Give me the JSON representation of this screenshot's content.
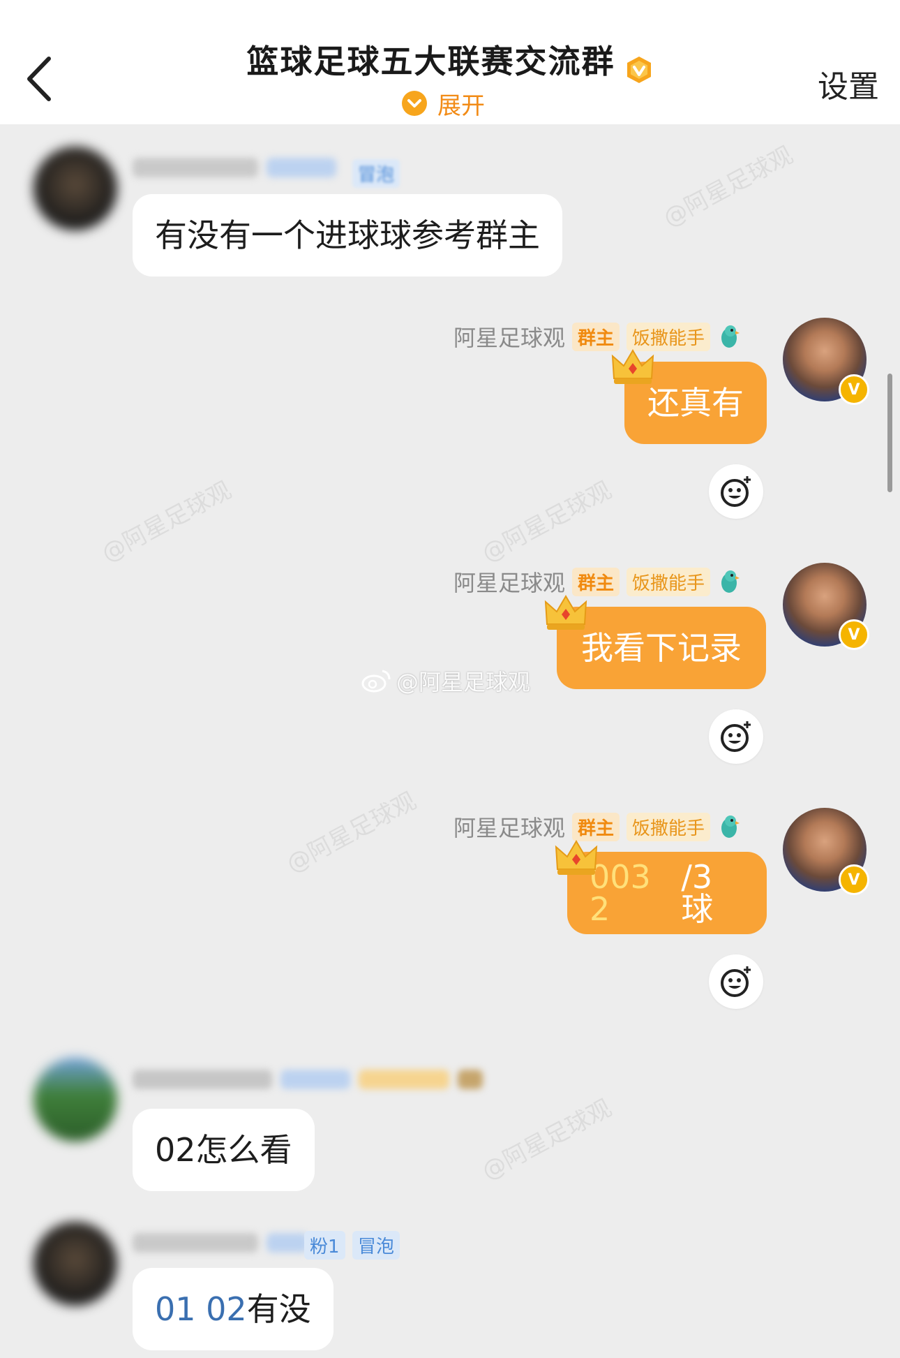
{
  "header": {
    "title": "篮球足球五大联赛交流群",
    "expand_label": "展开",
    "settings_label": "设置"
  },
  "colors": {
    "accent": "#f9a336",
    "badge_orange": "#f28b16",
    "background": "#ededed"
  },
  "watermark": {
    "text": "@阿星足球观",
    "weibo_text": "@阿星足球观"
  },
  "messages": [
    {
      "side": "left",
      "sender": "",
      "tags": [
        "冒泡"
      ],
      "text": "有没有一个进球球参考群主"
    },
    {
      "side": "right",
      "sender": "阿星足球观",
      "tags": [
        "群主",
        "饭撒能手"
      ],
      "text": "还真有"
    },
    {
      "side": "right",
      "sender": "阿星足球观",
      "tags": [
        "群主",
        "饭撒能手"
      ],
      "text": "我看下记录"
    },
    {
      "side": "right",
      "sender": "阿星足球观",
      "tags": [
        "群主",
        "饭撒能手"
      ],
      "text_a": "003 2",
      "text_b": "/3球"
    },
    {
      "side": "left",
      "sender": "",
      "tags": [],
      "text": "02怎么看"
    },
    {
      "side": "left",
      "sender": "",
      "tags": [
        "粉1",
        "冒泡"
      ],
      "text_a": "01 02",
      "text_b": "有没"
    }
  ]
}
